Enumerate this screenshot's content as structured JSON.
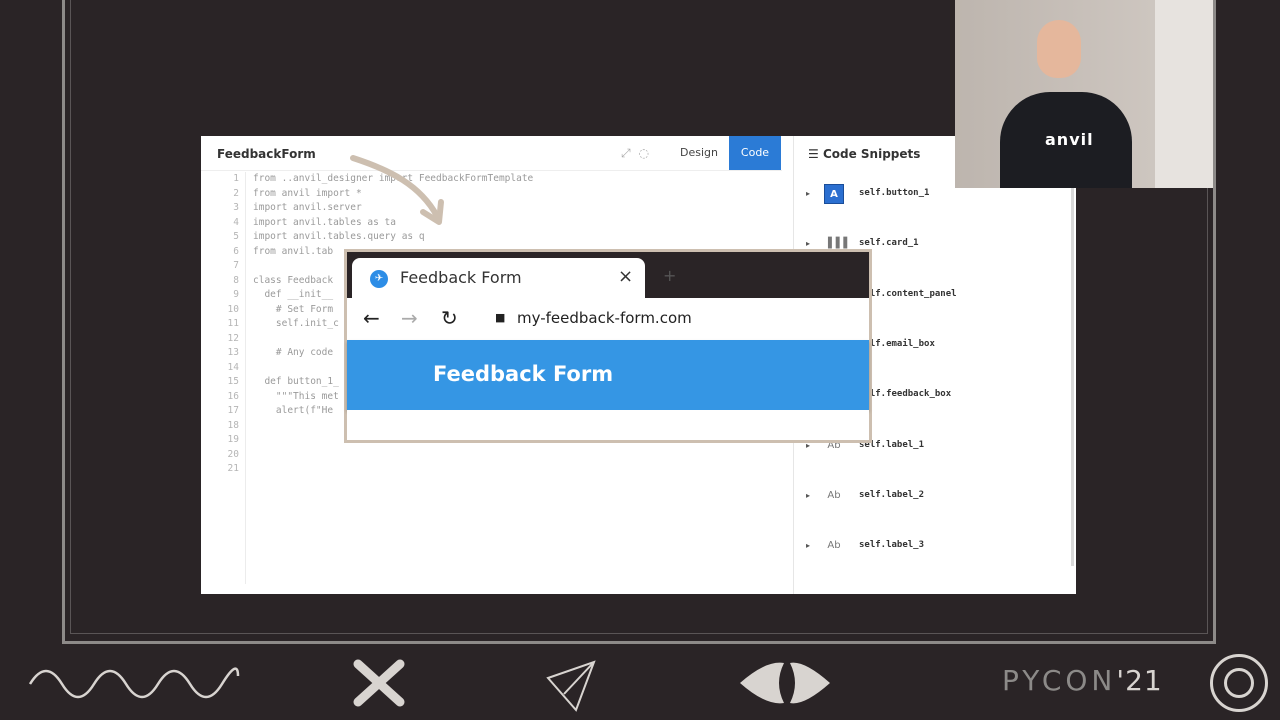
{
  "editor": {
    "title": "FeedbackForm",
    "icons": [
      "expand-icon",
      "help-icon"
    ],
    "design_label": "Design",
    "code_label": "Code",
    "active_tab": "Code",
    "accent_color": "#2b7bd6",
    "lines": [
      {
        "n": "1",
        "text": "from ..anvil_designer import FeedbackFormTemplate"
      },
      {
        "n": "2",
        "text": "from anvil import *"
      },
      {
        "n": "3",
        "text": "import anvil.server"
      },
      {
        "n": "4",
        "text": "import anvil.tables as ta"
      },
      {
        "n": "5",
        "text": "import anvil.tables.query as q"
      },
      {
        "n": "6",
        "text": "from anvil.tab"
      },
      {
        "n": "7",
        "text": ""
      },
      {
        "n": "8",
        "text": "class Feedback"
      },
      {
        "n": "9",
        "text": "  def __init__"
      },
      {
        "n": "10",
        "text": "    # Set Form"
      },
      {
        "n": "11",
        "text": "    self.init_c"
      },
      {
        "n": "12",
        "text": ""
      },
      {
        "n": "13",
        "text": "    # Any code"
      },
      {
        "n": "14",
        "text": ""
      },
      {
        "n": "15",
        "text": "  def button_1_"
      },
      {
        "n": "16",
        "text": "    \"\"\"This met"
      },
      {
        "n": "17",
        "text": "    alert(f\"He"
      },
      {
        "n": "18",
        "text": ""
      },
      {
        "n": "19",
        "text": ""
      },
      {
        "n": "20",
        "text": ""
      },
      {
        "n": "21",
        "text": ""
      }
    ]
  },
  "snippets": {
    "title": "Code Snippets",
    "items": [
      {
        "label": "self.button_1",
        "icon_text": "A",
        "icon": "button-icon"
      },
      {
        "label": "self.card_1",
        "icon_text": "▐▐▐",
        "icon": "card-icon"
      },
      {
        "label": "self.content_panel",
        "icon_text": "",
        "icon": "panel-icon"
      },
      {
        "label": "self.email_box",
        "icon_text": "",
        "icon": "textbox-icon"
      },
      {
        "label": "self.feedback_box",
        "icon_text": "",
        "icon": "textarea-icon"
      },
      {
        "label": "self.label_1",
        "icon_text": "Ab",
        "icon": "label-icon"
      },
      {
        "label": "self.label_2",
        "icon_text": "Ab",
        "icon": "label-icon"
      },
      {
        "label": "self.label_3",
        "icon_text": "Ab",
        "icon": "label-icon"
      }
    ]
  },
  "browser": {
    "tab_title": "Feedback Form",
    "close_glyph": "×",
    "new_tab_glyph": "+",
    "back_glyph": "←",
    "forward_glyph": "→",
    "reload_glyph": "↻",
    "lock_glyph": "🔒",
    "url": "my-feedback-form.com",
    "page_heading": "Feedback Form",
    "header_color": "#3596e4"
  },
  "webcam": {
    "shirt_text": "anvil"
  },
  "footer": {
    "brand": "PYCON",
    "year": "'21",
    "icons": [
      "wave-icon",
      "cross-icon",
      "paper-plane-icon",
      "eye-icon",
      "target-icon"
    ]
  }
}
